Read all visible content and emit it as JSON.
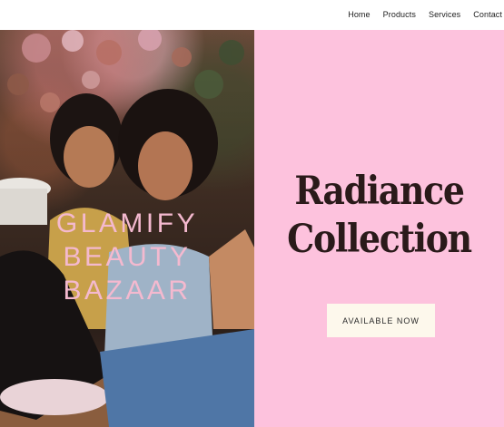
{
  "nav": {
    "items": [
      {
        "label": "Home"
      },
      {
        "label": "Products"
      },
      {
        "label": "Services"
      },
      {
        "label": "Contact"
      }
    ]
  },
  "hero": {
    "title_lines": [
      "GLAMIFY",
      "BEAUTY",
      "BAZAAR"
    ],
    "collection_lines": [
      "Radiance",
      "Collection"
    ],
    "cta_label": "AVAILABLE NOW"
  },
  "colors": {
    "accent_pink": "#fdc2dd",
    "title_pink": "#f4b9cf",
    "button_cream": "#fdf8ec",
    "text_dark": "#2a1a1a"
  }
}
